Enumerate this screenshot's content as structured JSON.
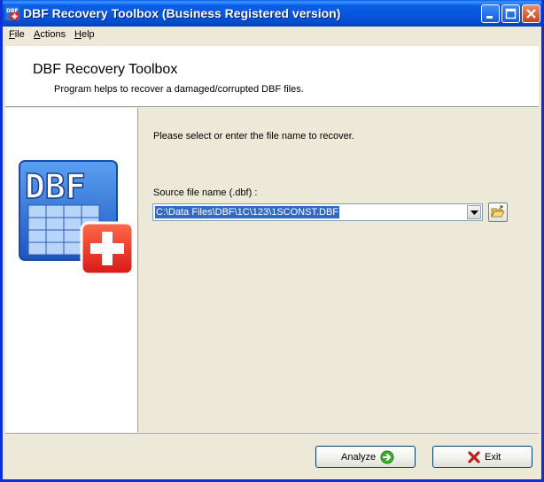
{
  "window": {
    "title": "DBF Recovery Toolbox (Business Registered version)",
    "icons": [
      "app-icon",
      "minimize-icon",
      "maximize-icon",
      "close-icon"
    ]
  },
  "menu": {
    "file": {
      "mnemonic": "F",
      "rest": "ile"
    },
    "actions": {
      "mnemonic": "A",
      "rest": "ctions"
    },
    "help": {
      "mnemonic": "H",
      "rest": "elp"
    }
  },
  "header": {
    "title": "DBF Recovery Toolbox",
    "subtitle": "Program helps to recover a damaged/corrupted DBF files."
  },
  "logo": {
    "text": "DBF"
  },
  "main": {
    "prompt": "Please select or enter the file name to recover.",
    "source_label": "Source file name (.dbf) :",
    "source_value": "C:\\Data Files\\DBF\\1C\\123\\1SCONST.DBF"
  },
  "buttons": {
    "analyze": "Analyze",
    "exit": "Exit"
  },
  "colors": {
    "titlebar": "#0a5fe8",
    "selection": "#316ac5",
    "dialog_bg": "#ece9d8"
  }
}
